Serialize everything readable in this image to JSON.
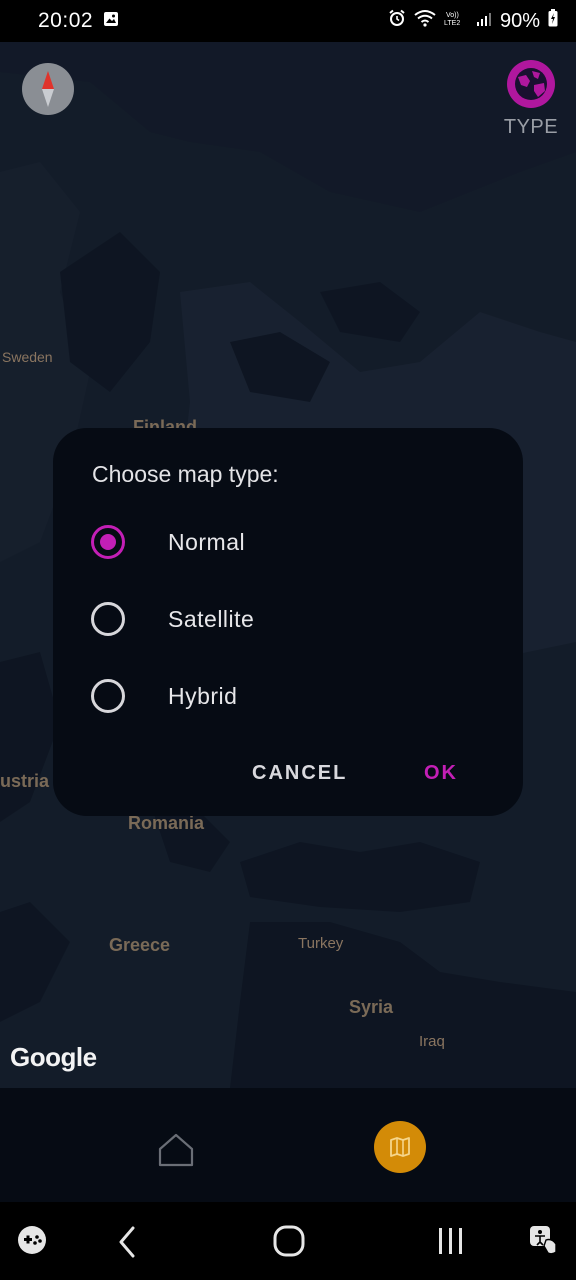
{
  "status_bar": {
    "time": "20:02",
    "battery": "90%"
  },
  "map": {
    "type_button_label": "TYPE",
    "google_logo": "Google",
    "labels": {
      "sweden": "Sweden",
      "finland": "Finland",
      "austria": "ustria",
      "romania": "Romania",
      "greece": "Greece",
      "turkey": "Turkey",
      "syria": "Syria",
      "iraq": "Iraq"
    }
  },
  "dialog": {
    "title": "Choose map type:",
    "options": [
      {
        "label": "Normal",
        "selected": true
      },
      {
        "label": "Satellite",
        "selected": false
      },
      {
        "label": "Hybrid",
        "selected": false
      }
    ],
    "cancel_label": "CANCEL",
    "ok_label": "OK",
    "accent_color": "#c31fb6"
  },
  "bottom_nav": {
    "icons": [
      "home-icon",
      "map-icon"
    ],
    "active_color": "#d38b07"
  },
  "system_nav": {
    "icons": [
      "game-launcher-icon",
      "back-icon",
      "home-icon",
      "recents-icon",
      "accessibility-icon"
    ]
  }
}
